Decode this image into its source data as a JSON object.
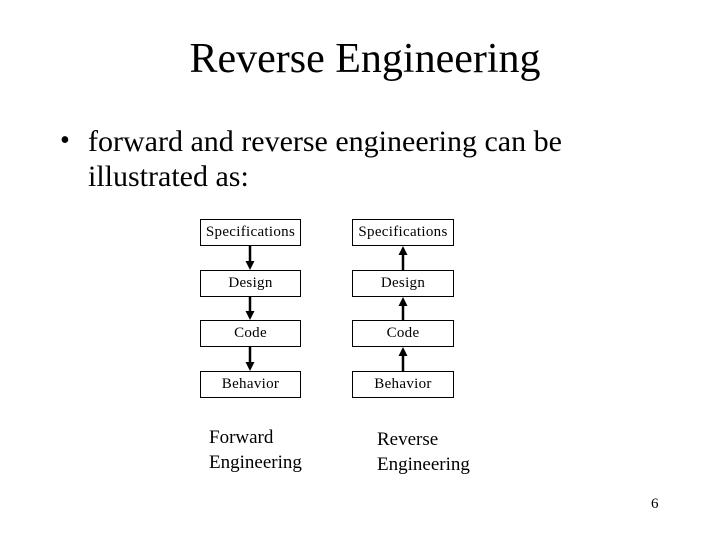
{
  "slide": {
    "title": "Reverse Engineering",
    "bullet_symbol": "•",
    "bullet_text": "forward and reverse engineering can be illustrated as:",
    "page_number": "6"
  },
  "diagram": {
    "forward": {
      "direction": "down",
      "boxes": [
        "Specifications",
        "Design",
        "Code",
        "Behavior"
      ],
      "caption_line1": "Forward",
      "caption_line2": "Engineering"
    },
    "reverse": {
      "direction": "up",
      "boxes": [
        "Specifications",
        "Design",
        "Code",
        "Behavior"
      ],
      "caption_line1": "Reverse",
      "caption_line2": "Engineering"
    }
  }
}
